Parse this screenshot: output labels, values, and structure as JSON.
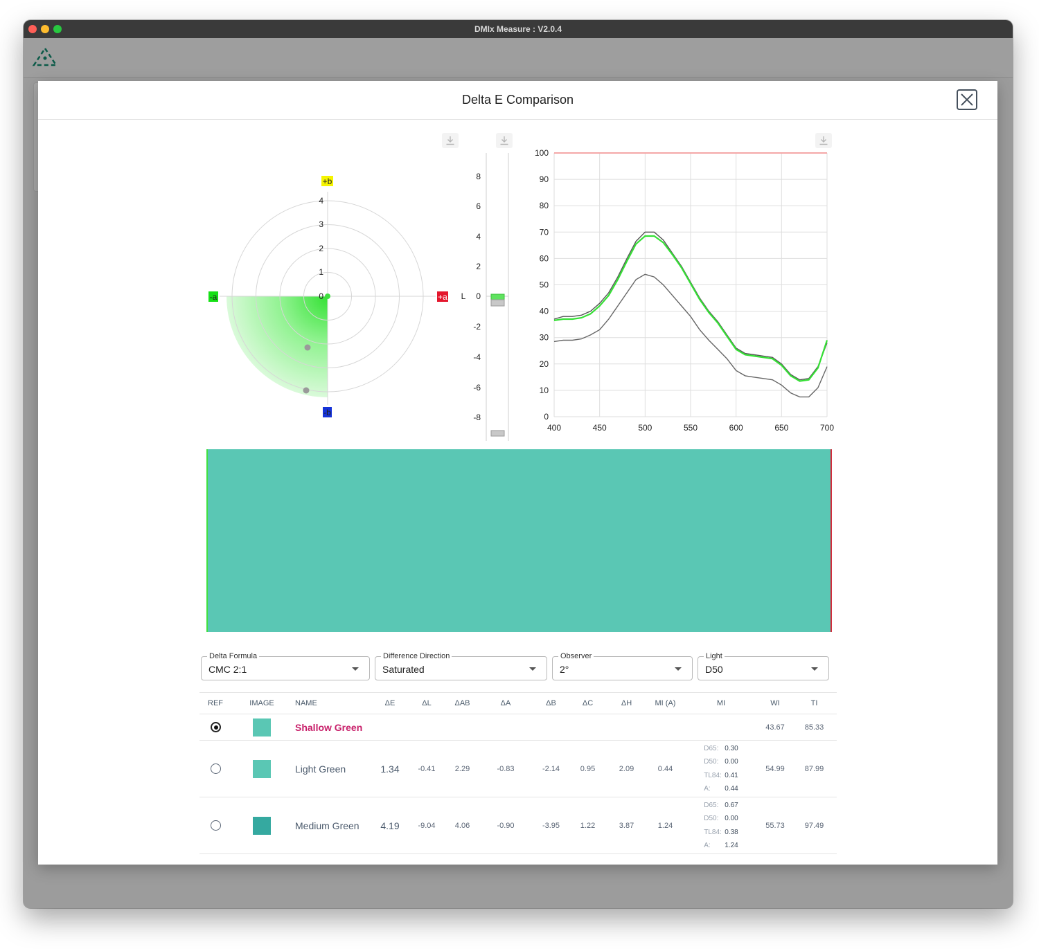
{
  "window": {
    "title": "DMIx Measure : V2.0.4"
  },
  "modal": {
    "title": "Delta E Comparison"
  },
  "polar": {
    "ring_labels": [
      "0",
      "1",
      "2",
      "3",
      "4"
    ],
    "axis_labels": {
      "pos_b": "+b",
      "neg_b": "-b",
      "neg_a": "-a",
      "pos_a": "+a"
    }
  },
  "lightness": {
    "label": "L",
    "ticks": [
      "8",
      "6",
      "4",
      "2",
      "0",
      "-2",
      "-4",
      "-6",
      "-8"
    ]
  },
  "colors": {
    "swatch_main": "#5ac7b4",
    "swatch_light": "#5ac7b4",
    "swatch_medium": "#35a9a0",
    "accent_ref": "#c8206a",
    "green_series": "#35e035",
    "gray_series": "#666666",
    "reference_line": "#f4a7a7"
  },
  "chart_data": {
    "type": "line",
    "xlim": [
      400,
      700
    ],
    "ylim": [
      0,
      100
    ],
    "x_ticks": [
      "400",
      "450",
      "500",
      "550",
      "600",
      "650",
      "700"
    ],
    "y_ticks": [
      "0",
      "10",
      "20",
      "30",
      "40",
      "50",
      "60",
      "70",
      "80",
      "90",
      "100"
    ],
    "x": [
      400,
      410,
      420,
      430,
      440,
      450,
      460,
      470,
      480,
      490,
      500,
      510,
      520,
      530,
      540,
      550,
      560,
      570,
      580,
      590,
      600,
      610,
      620,
      630,
      640,
      650,
      660,
      670,
      680,
      690,
      700
    ],
    "series": [
      {
        "color": "#666666",
        "values": [
          28.5,
          29,
          29,
          29.5,
          31,
          33,
          37,
          42,
          47,
          52,
          54,
          53,
          50,
          46,
          42,
          38,
          33,
          29,
          25.5,
          22,
          17.5,
          15.5,
          15,
          14.5,
          14,
          12,
          9,
          7.5,
          7.5,
          11,
          19
        ]
      },
      {
        "color": "#555555",
        "values": [
          37,
          38,
          38,
          38.5,
          40,
          43,
          47,
          53,
          60,
          66.5,
          70,
          70,
          67,
          62,
          57,
          51,
          45,
          40,
          36,
          31,
          26,
          24,
          23.5,
          23,
          22.5,
          20,
          16,
          14,
          14.5,
          19,
          28
        ]
      },
      {
        "color": "#35e035",
        "values": [
          36.5,
          37,
          37,
          37.5,
          39,
          42,
          46,
          52,
          59,
          65.5,
          68.5,
          68.5,
          66,
          61.5,
          56.5,
          50.5,
          44.5,
          39.5,
          35.5,
          30.5,
          25.5,
          23.5,
          23,
          22.5,
          22,
          19.5,
          15.5,
          13.5,
          14,
          18.5,
          29
        ]
      }
    ],
    "reference_line": 100
  },
  "controls": [
    {
      "label": "Delta Formula",
      "value": "CMC 2:1"
    },
    {
      "label": "Difference Direction",
      "value": "Saturated"
    },
    {
      "label": "Observer",
      "value": "2°"
    },
    {
      "label": "Light",
      "value": "D50"
    }
  ],
  "table": {
    "headers": [
      "REF",
      "IMAGE",
      "NAME",
      "ΔE",
      "ΔL",
      "ΔAB",
      "ΔA",
      "ΔB",
      "ΔC",
      "ΔH",
      "MI (A)",
      "MI",
      "WI",
      "TI"
    ],
    "mi_keys": [
      "D65:",
      "D50:",
      "TL84:",
      "A:"
    ],
    "reference": {
      "name": "Shallow Green",
      "wi": "43.67",
      "ti": "85.33"
    },
    "rows": [
      {
        "name": "Light Green",
        "de": "1.34",
        "dl": "-0.41",
        "dab": "2.29",
        "da": "-0.83",
        "db": "-2.14",
        "dc": "0.95",
        "dh": "2.09",
        "mia": "0.44",
        "mi": [
          "0.30",
          "0.00",
          "0.41",
          "0.44"
        ],
        "wi": "54.99",
        "ti": "87.99"
      },
      {
        "name": "Medium Green",
        "de": "4.19",
        "dl": "-9.04",
        "dab": "4.06",
        "da": "-0.90",
        "db": "-3.95",
        "dc": "1.22",
        "dh": "3.87",
        "mia": "1.24",
        "mi": [
          "0.67",
          "0.00",
          "0.38",
          "1.24"
        ],
        "wi": "55.73",
        "ti": "97.49"
      }
    ]
  }
}
